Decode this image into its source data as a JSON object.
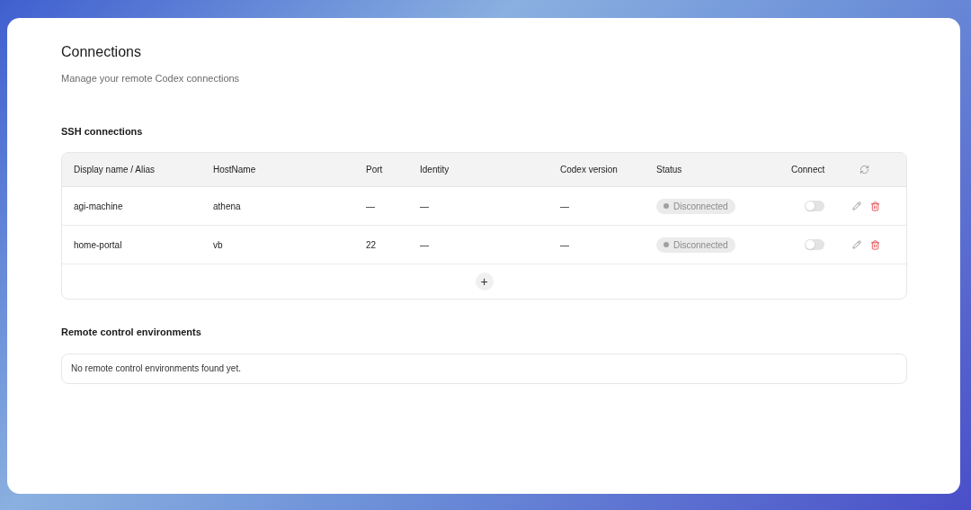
{
  "page": {
    "title": "Connections",
    "subtitle": "Manage your remote Codex connections"
  },
  "ssh": {
    "heading": "SSH connections",
    "columns": [
      "Display name / Alias",
      "HostName",
      "Port",
      "Identity",
      "Codex version",
      "Status",
      "Connect"
    ],
    "rows": [
      {
        "alias": "agi-machine",
        "hostname": "athena",
        "port": "—",
        "identity": "—",
        "codex_version": "—",
        "status": "Disconnected",
        "connected": false
      },
      {
        "alias": "home-portal",
        "hostname": "vb",
        "port": "22",
        "identity": "—",
        "codex_version": "—",
        "status": "Disconnected",
        "connected": false
      }
    ],
    "add_button": "+"
  },
  "remote": {
    "heading": "Remote control environments",
    "empty_message": "No remote control environments found yet."
  }
}
